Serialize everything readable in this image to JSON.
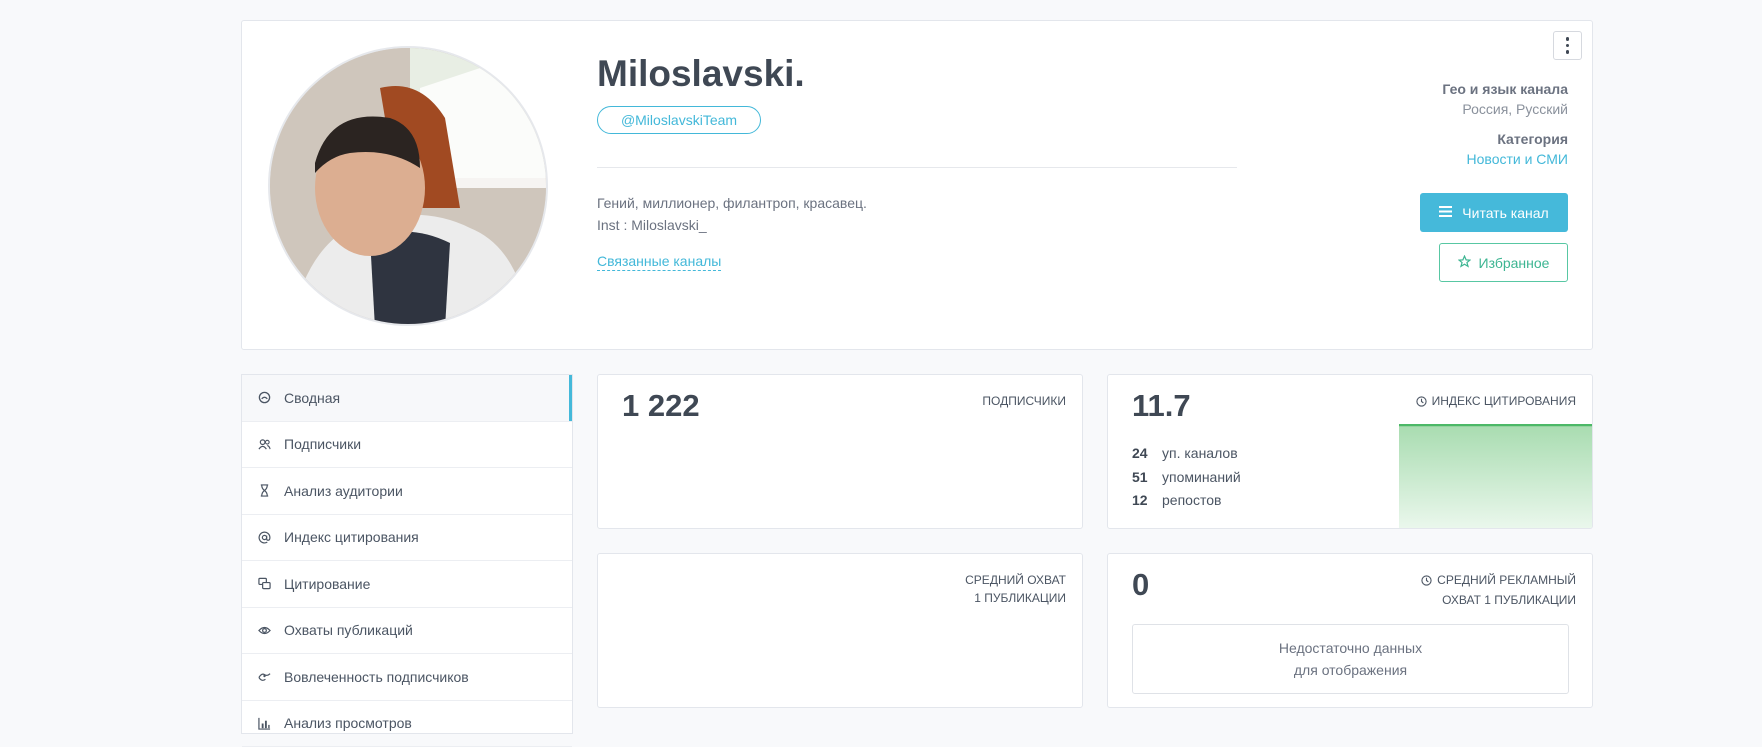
{
  "profile": {
    "title": "Miloslavski.",
    "handle": "@MiloslavskiTeam",
    "description_line1": "Гений, миллионер, филантроп, красавец.",
    "description_line2": "Inst : Miloslavski_",
    "related_link": "Связанные каналы",
    "geo_heading": "Гео и язык канала",
    "geo_value": "Россия, Русский",
    "category_heading": "Категория",
    "category_value": "Новости и СМИ",
    "read_button": "Читать канал",
    "favorite_button": "Избранное"
  },
  "sidebar": {
    "items": [
      {
        "label": "Сводная",
        "icon": "dashboard-icon"
      },
      {
        "label": "Подписчики",
        "icon": "users-icon"
      },
      {
        "label": "Анализ аудитории",
        "icon": "hourglass-icon"
      },
      {
        "label": "Индекс цитирования",
        "icon": "at-icon"
      },
      {
        "label": "Цитирование",
        "icon": "quote-icon"
      },
      {
        "label": "Охваты публикаций",
        "icon": "eye-icon"
      },
      {
        "label": "Вовлеченность подписчиков",
        "icon": "engagement-icon"
      },
      {
        "label": "Анализ просмотров",
        "icon": "bar-chart-icon"
      }
    ]
  },
  "cards": {
    "subscribers": {
      "value": "1 222",
      "label": "ПОДПИСЧИКИ"
    },
    "citation": {
      "value": "11.7",
      "label": "ИНДЕКС ЦИТИРОВАНИЯ",
      "rows": [
        {
          "num": "24",
          "text": "уп. каналов"
        },
        {
          "num": "51",
          "text": "упоминаний"
        },
        {
          "num": "12",
          "text": "репостов"
        }
      ]
    },
    "avg_reach": {
      "label_line1": "СРЕДНИЙ ОХВАТ",
      "label_line2": "1 ПУБЛИКАЦИИ"
    },
    "ad_reach": {
      "value": "0",
      "label_line1": "СРЕДНИЙ РЕКЛАМНЫЙ",
      "label_line2": "ОХВАТ 1 ПУБЛИКАЦИИ",
      "nodata_line1": "Недостаточно данных",
      "nodata_line2": "для отображения"
    }
  },
  "colors": {
    "accent": "#45b9da",
    "green": "#58c7a3"
  }
}
